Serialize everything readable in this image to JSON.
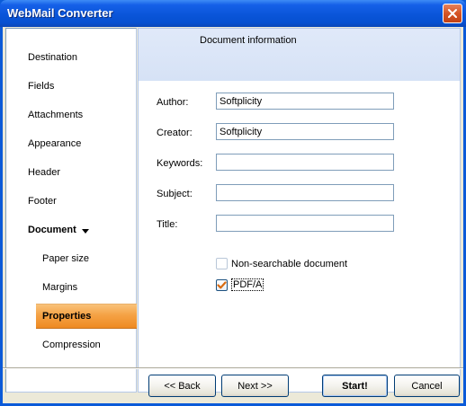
{
  "window": {
    "title": "WebMail Converter"
  },
  "nav": {
    "items": [
      {
        "label": "Destination"
      },
      {
        "label": "Fields"
      },
      {
        "label": "Attachments"
      },
      {
        "label": "Appearance"
      },
      {
        "label": "Header"
      },
      {
        "label": "Footer"
      },
      {
        "label": "Document"
      },
      {
        "label": "Paper size"
      },
      {
        "label": "Margins"
      },
      {
        "label": "Properties"
      },
      {
        "label": "Compression"
      }
    ],
    "selected": "Properties"
  },
  "panel": {
    "title": "Document information",
    "fields": [
      {
        "label": "Author:",
        "value": "Softplicity"
      },
      {
        "label": "Creator:",
        "value": "Softplicity"
      },
      {
        "label": "Keywords:",
        "value": ""
      },
      {
        "label": "Subject:",
        "value": ""
      },
      {
        "label": "Title:",
        "value": ""
      }
    ],
    "options": [
      {
        "label": "Non-searchable document",
        "checked": false
      },
      {
        "label": "PDF/A",
        "checked": true
      }
    ]
  },
  "buttons": {
    "back": "<< Back",
    "next": "Next >>",
    "start": "Start!",
    "cancel": "Cancel"
  },
  "colors": {
    "titlebar": "#0a55d9",
    "selected_nav": "#f5a245",
    "panel_header": "#d6e2f6"
  }
}
